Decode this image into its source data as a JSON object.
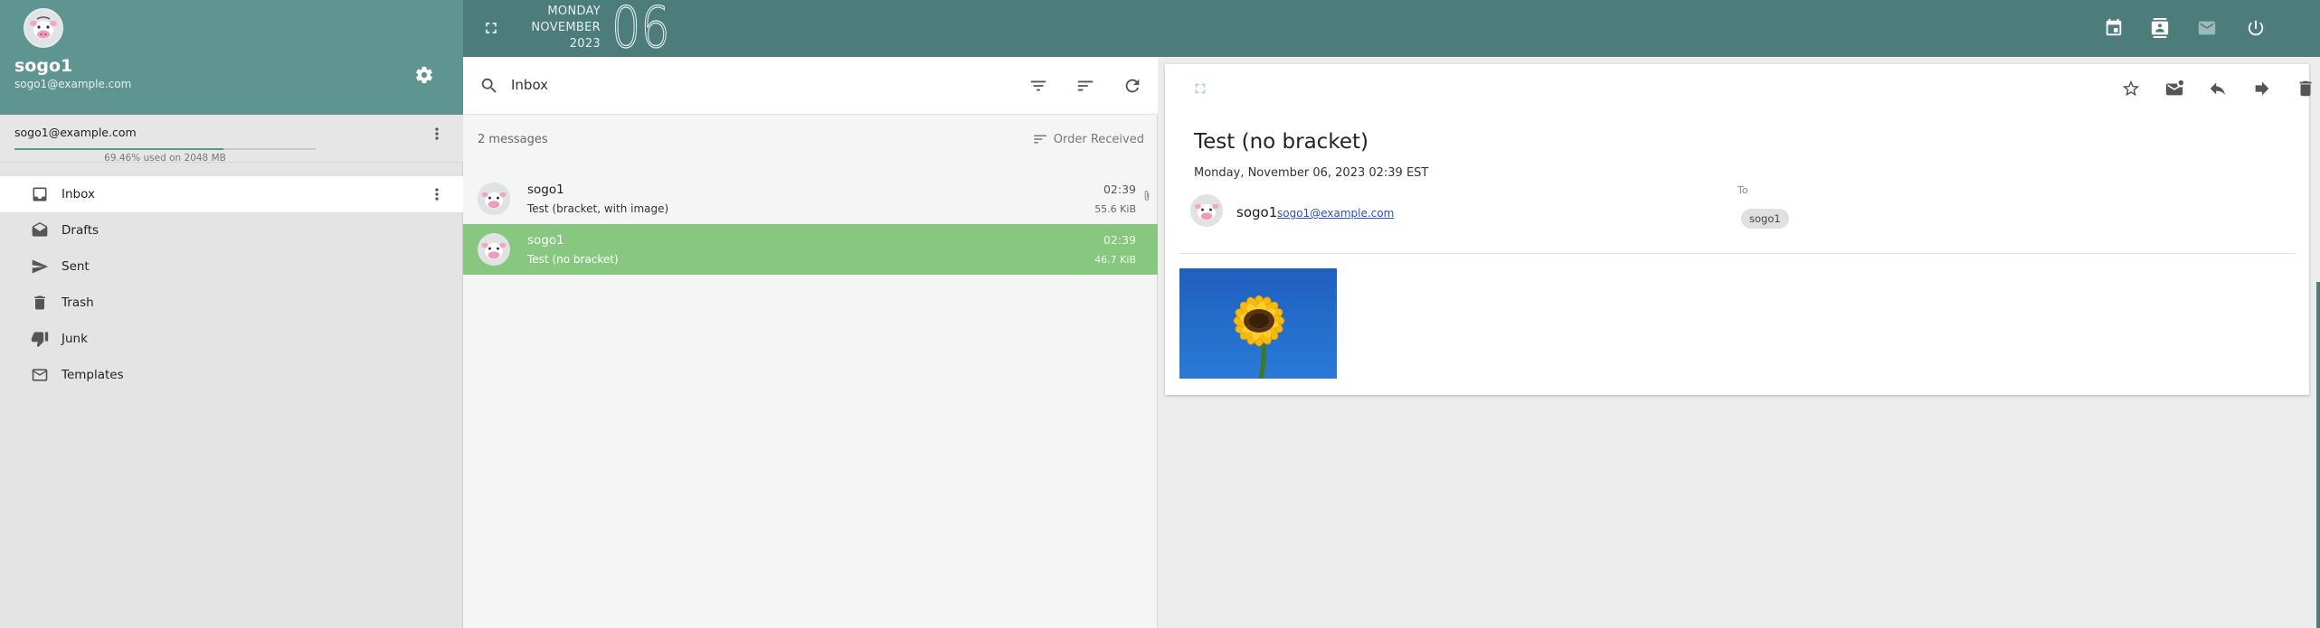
{
  "colors": {
    "header_teal": "#5f9590",
    "topbar_teal": "#4d7d7b",
    "selected_green": "#88c77f",
    "link_blue": "#2a52c8"
  },
  "sidebar": {
    "user": {
      "name": "sogo1",
      "email": "sogo1@example.com",
      "avatar_icon": "cow-avatar-icon"
    },
    "account": {
      "email": "sogo1@example.com",
      "quota_text": "69.46% used on 2048 MB",
      "quota_percent": 69.46
    },
    "folders": [
      {
        "label": "Inbox",
        "icon": "inbox-icon",
        "active": true
      },
      {
        "label": "Drafts",
        "icon": "drafts-icon"
      },
      {
        "label": "Sent",
        "icon": "send-icon"
      },
      {
        "label": "Trash",
        "icon": "trash-icon"
      },
      {
        "label": "Junk",
        "icon": "thumb-down-icon"
      },
      {
        "label": "Templates",
        "icon": "mail-outline-icon"
      }
    ]
  },
  "topbar": {
    "weekday": "MONDAY",
    "month": "NOVEMBER",
    "year": "2023",
    "day": "06",
    "icons": [
      "calendar-icon",
      "contacts-icon",
      "mail-icon",
      "power-icon"
    ]
  },
  "list": {
    "folder_title": "Inbox",
    "message_count": "2 messages",
    "sort_label": "Order Received",
    "messages": [
      {
        "sender": "sogo1",
        "subject": "Test (bracket, with image)",
        "time": "02:39",
        "size": "55.6 KiB",
        "has_attachment": true,
        "selected": false
      },
      {
        "sender": "sogo1",
        "subject": "Test (no bracket)",
        "time": "02:39",
        "size": "46.7 KiB",
        "has_attachment": false,
        "selected": true
      }
    ]
  },
  "reader": {
    "subject": "Test (no bracket)",
    "date": "Monday, November 06, 2023 02:39 EST",
    "from_name": "sogo1",
    "from_email": "sogo1@example.com",
    "to_label": "To",
    "to_recipient": "sogo1",
    "attachment_image": "sunflower-image"
  }
}
